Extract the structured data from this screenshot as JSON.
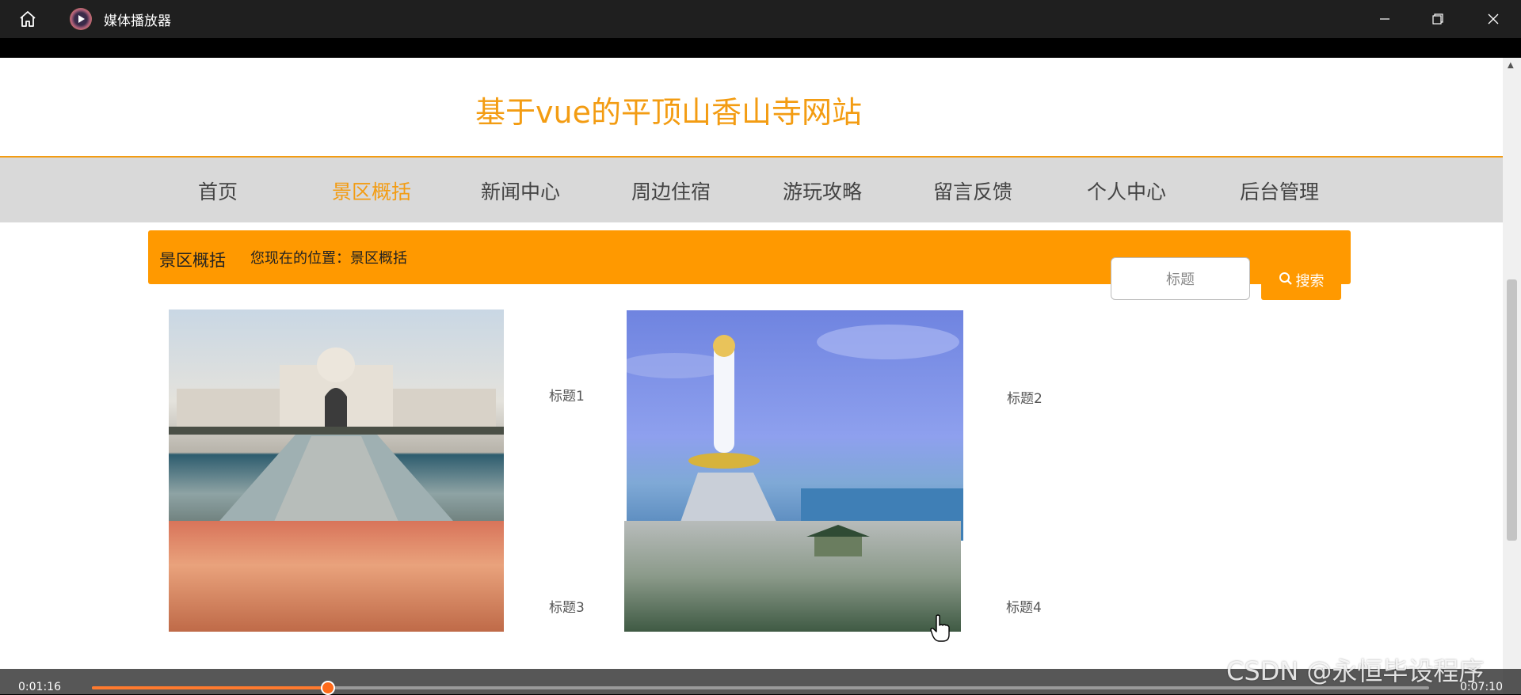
{
  "player": {
    "title": "媒体播放器",
    "current_time": "0:01:16",
    "total_time": "0:07:10",
    "progress": 0.1767,
    "accent": "#ff7a2e"
  },
  "site": {
    "title": "基于vue的平顶山香山寺网站",
    "accent": "#f39c12",
    "nav": [
      {
        "label": "首页",
        "active": false
      },
      {
        "label": "景区概括",
        "active": true
      },
      {
        "label": "新闻中心",
        "active": false
      },
      {
        "label": "周边住宿",
        "active": false
      },
      {
        "label": "游玩攻略",
        "active": false
      },
      {
        "label": "留言反馈",
        "active": false
      },
      {
        "label": "个人中心",
        "active": false
      },
      {
        "label": "后台管理",
        "active": false
      }
    ],
    "breadcrumb": {
      "title": "景区概括",
      "path": "您现在的位置：景区概括"
    },
    "search": {
      "placeholder": "标题",
      "button": "搜索"
    },
    "cards": [
      {
        "title": "标题1"
      },
      {
        "title": "标题2"
      },
      {
        "title": "标题3"
      },
      {
        "title": "标题4"
      }
    ]
  },
  "icons": [
    "home-icon",
    "media-player-icon",
    "minimize-icon",
    "maximize-icon",
    "close-icon",
    "search-icon",
    "hand-cursor-icon"
  ],
  "watermark": "CSDN @永恒毕设程序"
}
